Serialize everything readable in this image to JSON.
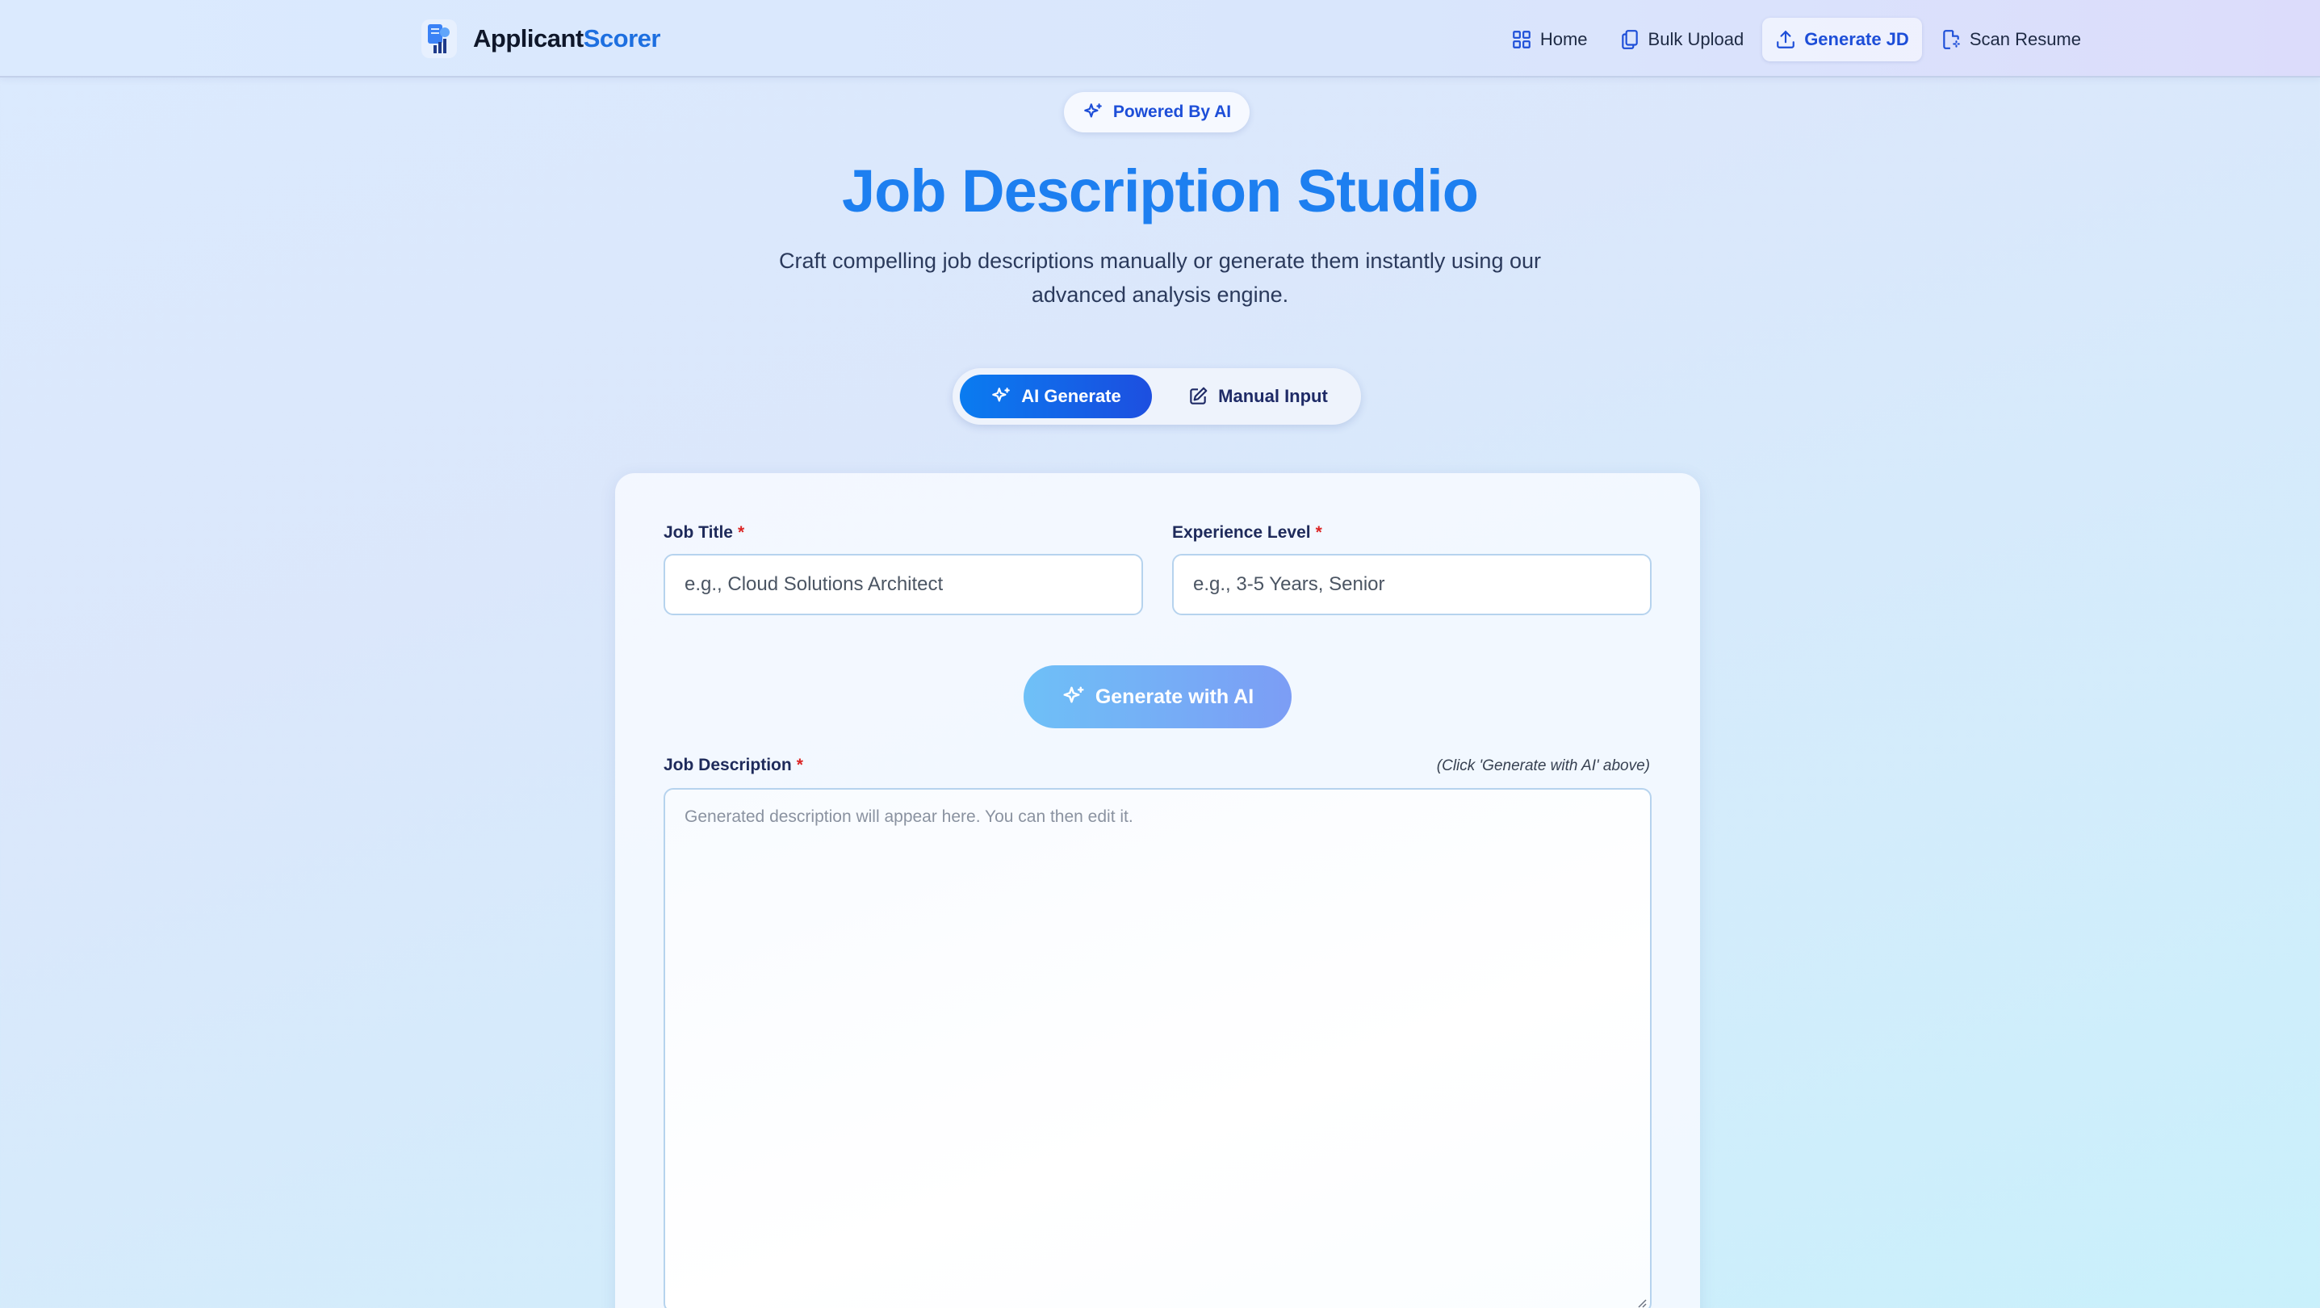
{
  "nav": {
    "brand_first": "Applicant",
    "brand_second": "Scorer",
    "brand_icon": "resume-chart-icon",
    "items": [
      {
        "label": "Home",
        "icon": "grid-icon",
        "active": false
      },
      {
        "label": "Bulk Upload",
        "icon": "files-icon",
        "active": false
      },
      {
        "label": "Generate JD",
        "icon": "upload-icon",
        "active": true
      },
      {
        "label": "Scan Resume",
        "icon": "file-scan-icon",
        "active": false
      }
    ]
  },
  "hero": {
    "badge": "Powered By AI",
    "title": "Job Description Studio",
    "subtitle": "Craft compelling job descriptions manually or generate them instantly using our advanced analysis engine."
  },
  "mode_toggle": {
    "ai_label": "AI Generate",
    "manual_label": "Manual Input",
    "selected": "AI Generate"
  },
  "form": {
    "job_title_label": "Job Title",
    "job_title_placeholder": "e.g., Cloud Solutions Architect",
    "experience_label": "Experience Level",
    "experience_placeholder": "e.g., 3-5 Years, Senior",
    "required_mark": "*",
    "generate_button": "Generate with AI",
    "description_label": "Job Description",
    "description_hint": "(Click 'Generate with AI' above)",
    "description_placeholder": "Generated description will appear here. You can then edit it."
  },
  "colors": {
    "accent": "#1d7ff0",
    "primary_dark": "#1d4ed8",
    "required": "#dc2626"
  }
}
